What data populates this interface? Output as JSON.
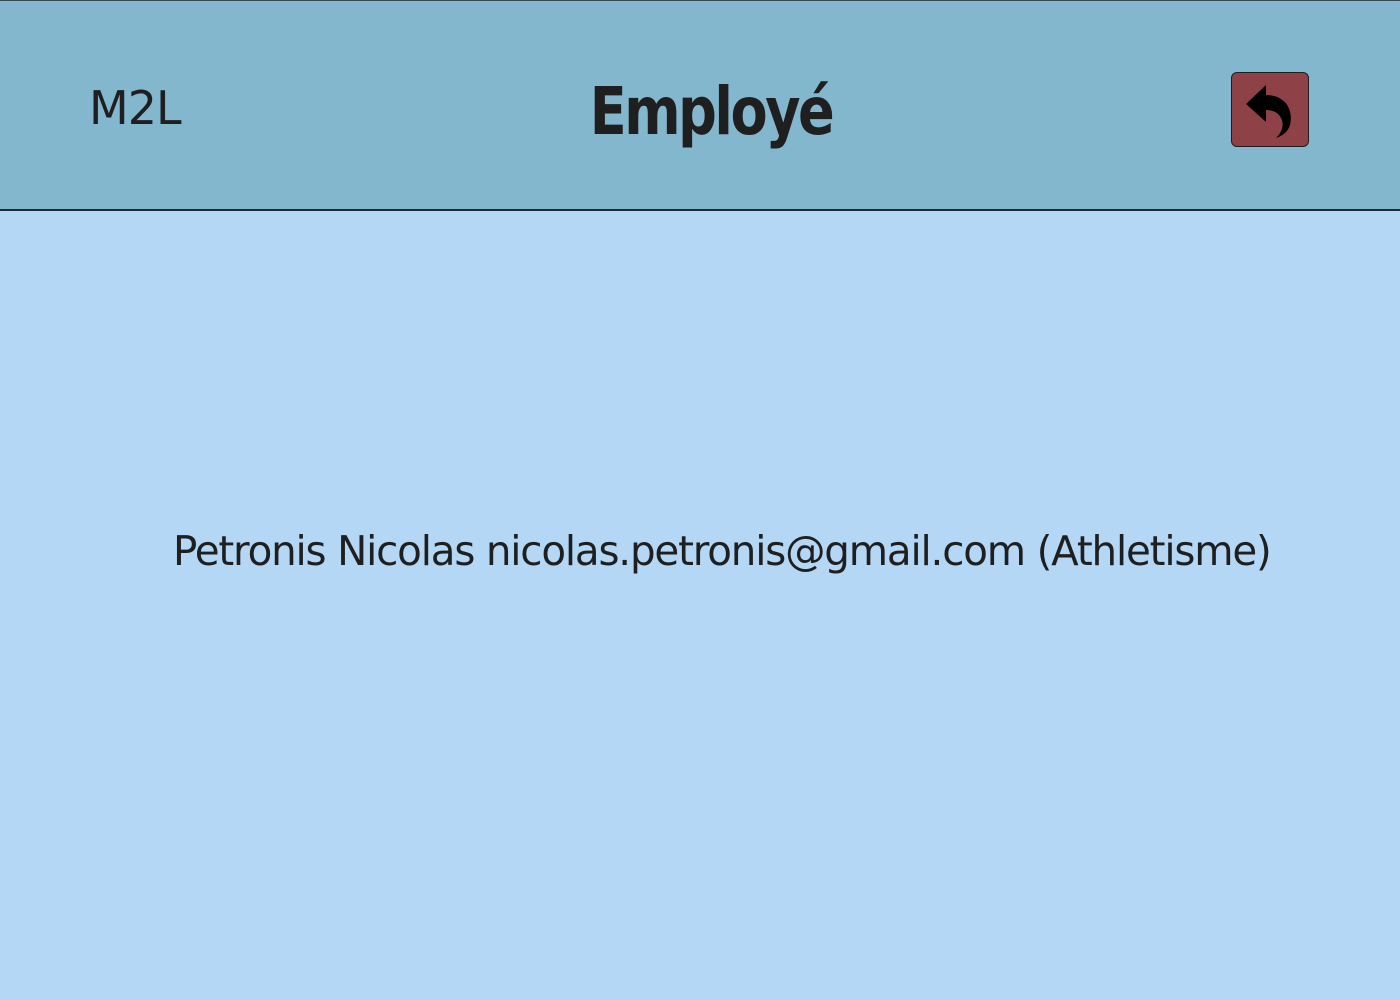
{
  "header": {
    "brand": "M2L",
    "title": "Employé",
    "back_icon": "undo-arrow-icon",
    "back_button_color": "#8e4247",
    "background_color": "#83b7ce"
  },
  "main": {
    "background_color": "#b3d7f5",
    "employee": {
      "last_name": "Petronis",
      "first_name": "Nicolas",
      "email": "nicolas.petronis@gmail.com",
      "sport": "(Athletisme)"
    }
  }
}
